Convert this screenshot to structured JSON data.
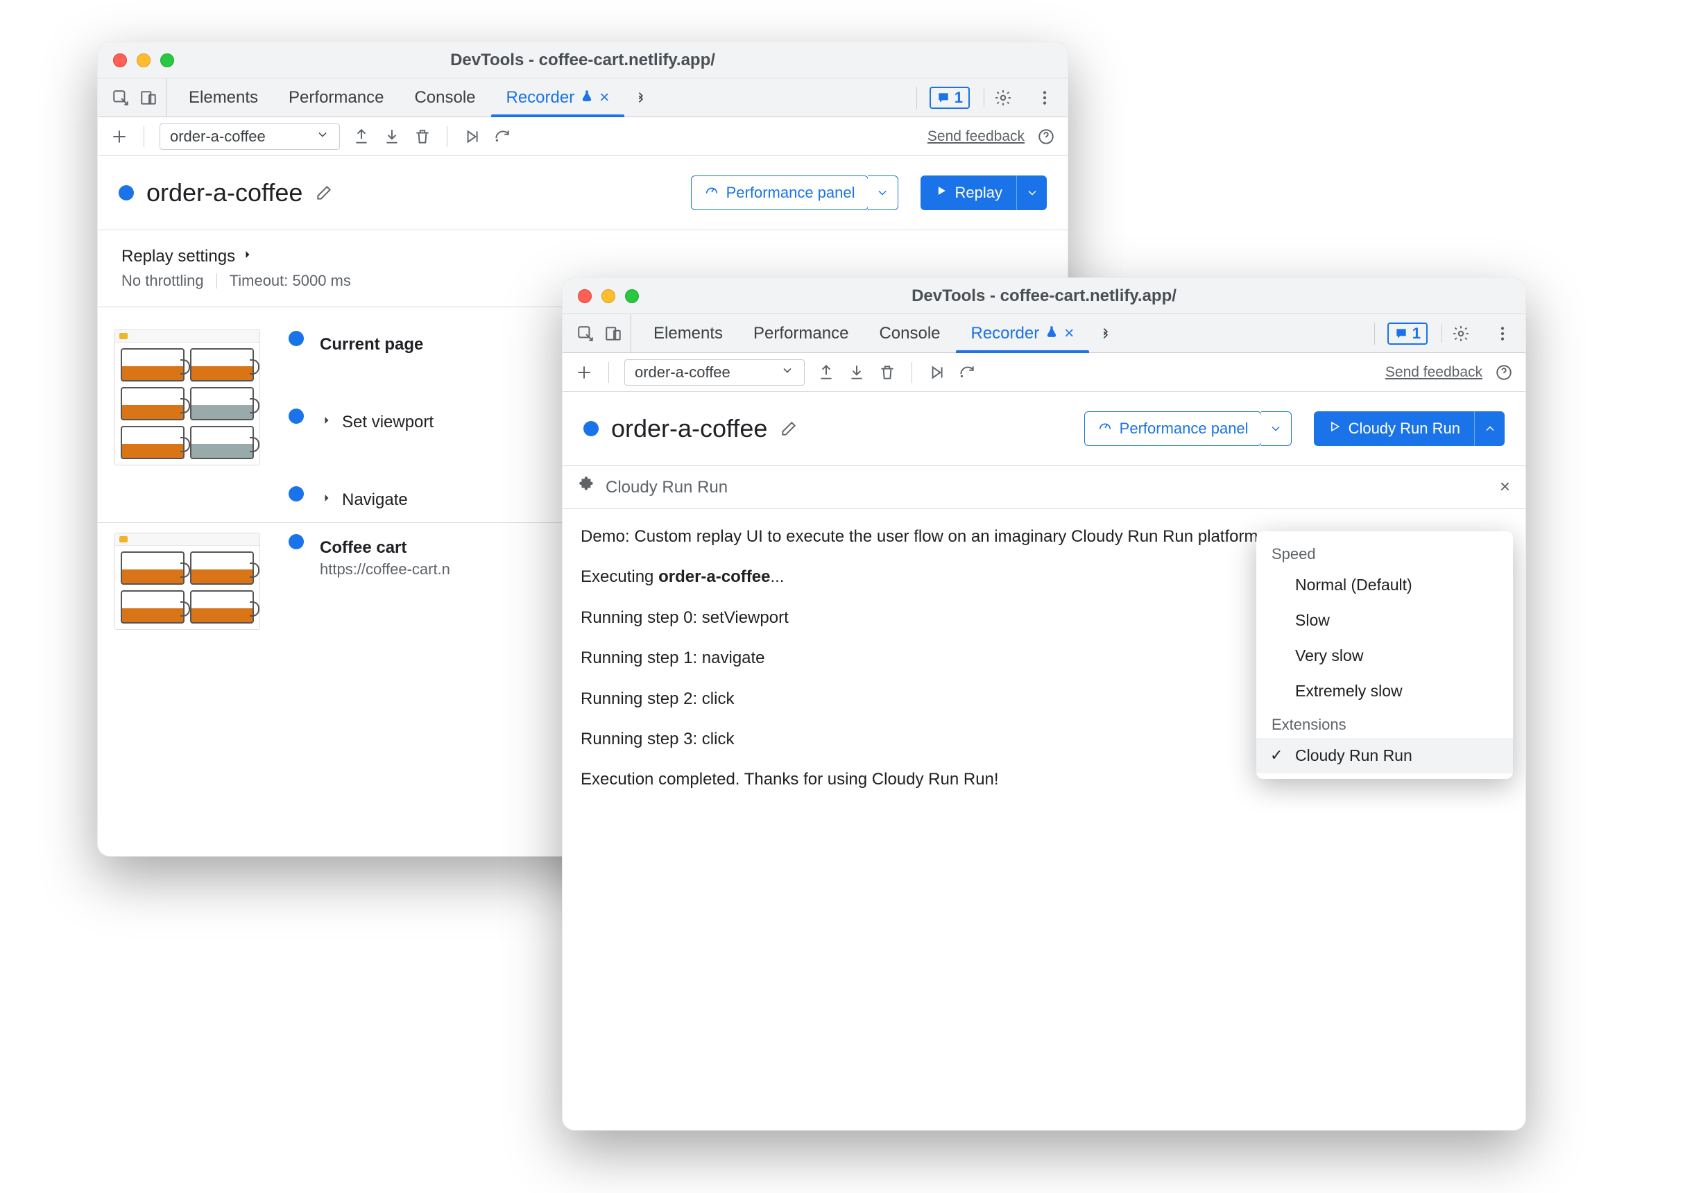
{
  "windowA": {
    "title": "DevTools - coffee-cart.netlify.app/",
    "tabs": [
      "Elements",
      "Performance",
      "Console",
      "Recorder"
    ],
    "activeTab": "Recorder",
    "issueCount": "1",
    "toolbar": {
      "recordingName": "order-a-coffee",
      "feedback": "Send feedback"
    },
    "recording": {
      "title": "order-a-coffee",
      "perfPanel": "Performance panel",
      "replay": "Replay"
    },
    "settings": {
      "heading": "Replay settings",
      "throttle": "No throttling",
      "timeout": "Timeout: 5000 ms"
    },
    "steps": [
      {
        "title": "Current page",
        "sub": null,
        "expandable": false
      },
      {
        "title": "Set viewport",
        "sub": null,
        "expandable": true
      },
      {
        "title": "Navigate",
        "sub": null,
        "expandable": true
      },
      {
        "title": "Coffee cart",
        "sub": "https://coffee-cart.n",
        "expandable": false
      }
    ]
  },
  "windowB": {
    "title": "DevTools - coffee-cart.netlify.app/",
    "tabs": [
      "Elements",
      "Performance",
      "Console",
      "Recorder"
    ],
    "activeTab": "Recorder",
    "issueCount": "1",
    "toolbar": {
      "recordingName": "order-a-coffee",
      "feedback": "Send feedback"
    },
    "recording": {
      "title": "order-a-coffee",
      "perfPanel": "Performance panel",
      "run": "Cloudy Run Run"
    },
    "extension": {
      "name": "Cloudy Run Run",
      "lines": [
        "Demo: Custom replay UI to execute the user flow on an imaginary Cloudy Run Run platform.",
        "Executing <b>order-a-coffee</b>...",
        "Running step 0: setViewport",
        "Running step 1: navigate",
        "Running step 2: click",
        "Running step 3: click",
        "Execution completed. Thanks for using Cloudy Run Run!"
      ]
    },
    "menu": {
      "groups": [
        {
          "title": "Speed",
          "items": [
            "Normal (Default)",
            "Slow",
            "Very slow",
            "Extremely slow"
          ]
        },
        {
          "title": "Extensions",
          "items": [
            "Cloudy Run Run"
          ]
        }
      ],
      "selected": "Cloudy Run Run"
    }
  }
}
